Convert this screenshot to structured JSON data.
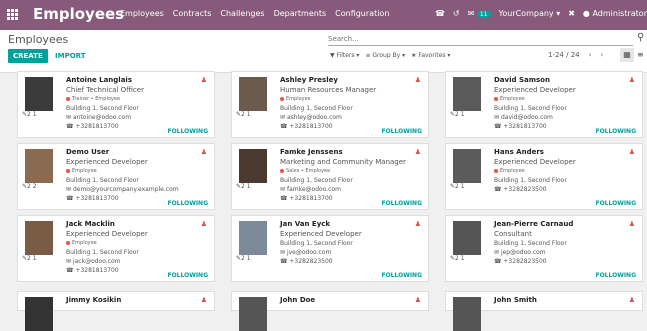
{
  "topbar": {
    "app_title": "Employees",
    "menu": [
      "Employees",
      "Contracts",
      "Challenges",
      "Departments",
      "Configuration"
    ],
    "chat_count": "11",
    "company": "YourCompany ▾",
    "user": "Administrator"
  },
  "control": {
    "breadcrumb": "Employees",
    "search_placeholder": "Search...",
    "create_label": "CREATE",
    "import_label": "IMPORT",
    "filters_label": "▼ Filters ▾",
    "groupby_label": "≡ Group By ▾",
    "favorites_label": "★ Favorites ▾",
    "pager": "1-24 / 24"
  },
  "employees": [
    {
      "name": "Antoine Langlais",
      "job": "Chief Technical Officer",
      "tags": "Trainer • Employee",
      "location": "Building 1, Second Floor",
      "email": "antoine@odoo.com",
      "phone": "+3281813700",
      "follow": "FOLLOWING",
      "counters": "2  1",
      "avatar_color": "#3b3b3b",
      "has_tags": true
    },
    {
      "name": "Ashley Presley",
      "job": "Human Resources Manager",
      "tags": "Employee",
      "location": "Building 1, Second Floor",
      "email": "ashley@odoo.com",
      "phone": "+3281813700",
      "follow": "FOLLOWING",
      "counters": "2  1",
      "avatar_color": "#6b5a4e",
      "has_tags": true
    },
    {
      "name": "David Samson",
      "job": "Experienced Developer",
      "tags": "Employee",
      "location": "Building 1, Second Floor",
      "email": "david@odoo.com",
      "phone": "+3281813700",
      "follow": "FOLLOWING",
      "counters": "2  1",
      "avatar_color": "#5a5a5a",
      "has_tags": true
    },
    {
      "name": "Demo User",
      "job": "Experienced Developer",
      "tags": "Employee",
      "location": "Building 1, Second Floor",
      "email": "demo@yourcompany.example.com",
      "phone": "+3281813700",
      "follow": "FOLLOWING",
      "counters": "2  2",
      "avatar_color": "#8a6b52",
      "has_tags": true
    },
    {
      "name": "Famke Jenssens",
      "job": "Marketing and Community Manager",
      "tags": "Sales • Employee",
      "location": "Building 1, Second Floor",
      "email": "famke@odoo.com",
      "phone": "+3281813700",
      "follow": "FOLLOWING",
      "counters": "2  1",
      "avatar_color": "#4a3a30",
      "has_tags": true
    },
    {
      "name": "Hans Anders",
      "job": "Experienced Developer",
      "tags": "Employee",
      "location": "Building 1, Second Floor",
      "email": "",
      "phone": "+3282823500",
      "follow": "FOLLOWING",
      "counters": "2  1",
      "avatar_color": "#5b5b5b",
      "has_tags": true
    },
    {
      "name": "Jack Macklin",
      "job": "Experienced Developer",
      "tags": "Employee",
      "location": "Building 1, Second Floor",
      "email": "jack@odoo.com",
      "phone": "+3281813700",
      "follow": "FOLLOWING",
      "counters": "2  1",
      "avatar_color": "#7a5b45",
      "has_tags": true
    },
    {
      "name": "Jan Van Eyck",
      "job": "Experienced Developer",
      "tags": "",
      "location": "Building 1, Second Floor",
      "email": "jve@odoo.com",
      "phone": "+3282823500",
      "follow": "FOLLOWING",
      "counters": "2  1",
      "avatar_color": "#7d8a9a",
      "has_tags": false
    },
    {
      "name": "Jean-Pierre Carnaud",
      "job": "Consultant",
      "tags": "",
      "location": "Building 1, Second Floor",
      "email": "jep@odoo.com",
      "phone": "+3282823500",
      "follow": "FOLLOWING",
      "counters": "2  1",
      "avatar_color": "#555555",
      "has_tags": false
    },
    {
      "name": "Jimmy Kosikin",
      "job": "",
      "tags": "",
      "location": "",
      "email": "",
      "phone": "",
      "follow": "",
      "counters": "",
      "avatar_color": "#333333",
      "has_tags": false
    },
    {
      "name": "John Doe",
      "job": "",
      "tags": "",
      "location": "",
      "email": "",
      "phone": "",
      "follow": "",
      "counters": "",
      "avatar_color": "#555555",
      "has_tags": false
    },
    {
      "name": "John Smith",
      "job": "",
      "tags": "",
      "location": "",
      "email": "",
      "phone": "",
      "follow": "",
      "counters": "",
      "avatar_color": "#555555",
      "has_tags": false
    }
  ]
}
